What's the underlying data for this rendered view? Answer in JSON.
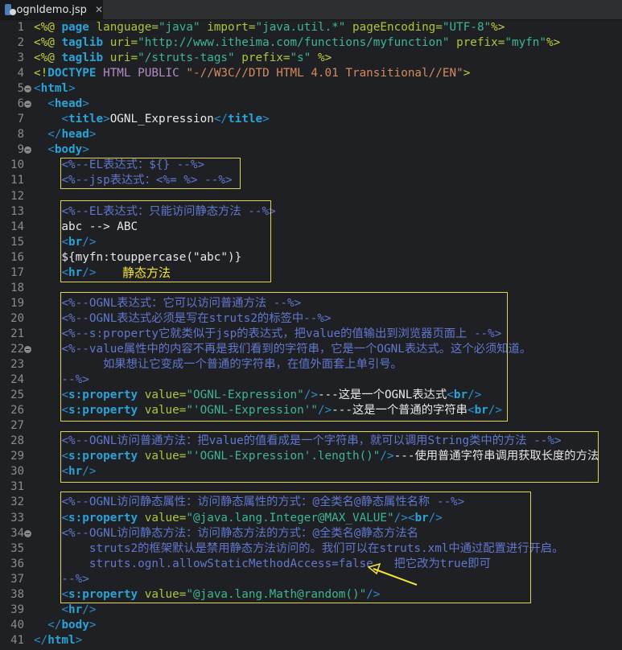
{
  "tab": {
    "title": "ognldemo.jsp",
    "icon": "jsp-file-icon",
    "close_icon": "close-icon"
  },
  "annotation": {
    "label": "静态方法",
    "arrow_icon": "arrow-icon",
    "box_color": "#e3d44a"
  },
  "fold_lines": [
    5,
    6,
    9,
    22,
    34
  ],
  "lines": [
    {
      "n": "1",
      "tokens": [
        [
          "p",
          "<%@ "
        ],
        [
          "kw",
          "page"
        ],
        [
          "at",
          " language="
        ],
        [
          "str",
          "\"java\""
        ],
        [
          "at",
          " import="
        ],
        [
          "str",
          "\"java.util.*\""
        ],
        [
          "at",
          " pageEncoding="
        ],
        [
          "str",
          "\"UTF-8\""
        ],
        [
          "p",
          "%>"
        ]
      ]
    },
    {
      "n": "2",
      "tokens": [
        [
          "p",
          "<%@ "
        ],
        [
          "kw",
          "taglib"
        ],
        [
          "at",
          " uri="
        ],
        [
          "str",
          "\"http://www.itheima.com/functions/myfunction\""
        ],
        [
          "at",
          " prefix="
        ],
        [
          "str",
          "\"myfn\""
        ],
        [
          "p",
          "%>"
        ]
      ]
    },
    {
      "n": "3",
      "tokens": [
        [
          "p",
          "<%@ "
        ],
        [
          "kw",
          "taglib"
        ],
        [
          "at",
          " uri="
        ],
        [
          "str",
          "\"/struts-tags\""
        ],
        [
          "at",
          " prefix="
        ],
        [
          "str",
          "\"s\""
        ],
        [
          "p",
          " %>"
        ]
      ]
    },
    {
      "n": "4",
      "tokens": [
        [
          "p",
          "<!"
        ],
        [
          "kw",
          "DOCTYPE"
        ],
        [
          "pu",
          " HTML PUBLIC "
        ],
        [
          "os",
          "\"-//W3C//DTD HTML 4.01 Transitional//EN\""
        ],
        [
          "p",
          ">"
        ]
      ]
    },
    {
      "n": "5",
      "tokens": [
        [
          "tg",
          "<"
        ],
        [
          "kw",
          "html"
        ],
        [
          "tg",
          ">"
        ]
      ]
    },
    {
      "n": "6",
      "tokens": [
        [
          "tx",
          "  "
        ],
        [
          "tg",
          "<"
        ],
        [
          "kw",
          "head"
        ],
        [
          "tg",
          ">"
        ]
      ]
    },
    {
      "n": "7",
      "tokens": [
        [
          "tx",
          "    "
        ],
        [
          "tg",
          "<"
        ],
        [
          "kw",
          "title"
        ],
        [
          "tg",
          ">"
        ],
        [
          "tx",
          "OGNL_Expression"
        ],
        [
          "tg",
          "</"
        ],
        [
          "kw",
          "title"
        ],
        [
          "tg",
          ">"
        ]
      ]
    },
    {
      "n": "8",
      "tokens": [
        [
          "tx",
          "  "
        ],
        [
          "tg",
          "</"
        ],
        [
          "kw",
          "head"
        ],
        [
          "tg",
          ">"
        ]
      ]
    },
    {
      "n": "9",
      "tokens": [
        [
          "tx",
          "  "
        ],
        [
          "tg",
          "<"
        ],
        [
          "kw",
          "body"
        ],
        [
          "tg",
          ">"
        ]
      ]
    },
    {
      "n": "10",
      "tokens": [
        [
          "tx",
          "    "
        ],
        [
          "cm",
          "<%--EL表达式：${} --%>"
        ]
      ]
    },
    {
      "n": "11",
      "tokens": [
        [
          "tx",
          "    "
        ],
        [
          "cm",
          "<%--jsp表达式：<%= %> --%>"
        ]
      ]
    },
    {
      "n": "12",
      "tokens": []
    },
    {
      "n": "13",
      "tokens": [
        [
          "tx",
          "    "
        ],
        [
          "cm",
          "<%--EL表达式：只能访问静态方法 --%>"
        ]
      ]
    },
    {
      "n": "14",
      "tokens": [
        [
          "tx",
          "    abc --> ABC"
        ]
      ]
    },
    {
      "n": "15",
      "tokens": [
        [
          "tx",
          "    "
        ],
        [
          "tg",
          "<"
        ],
        [
          "kw",
          "br"
        ],
        [
          "tg",
          "/>"
        ]
      ]
    },
    {
      "n": "16",
      "tokens": [
        [
          "tx",
          "    ${myfn:touppercase(\"abc\")}"
        ]
      ]
    },
    {
      "n": "17",
      "tokens": [
        [
          "tx",
          "    "
        ],
        [
          "tg",
          "<"
        ],
        [
          "kw",
          "hr"
        ],
        [
          "tg",
          "/>"
        ]
      ]
    },
    {
      "n": "18",
      "tokens": []
    },
    {
      "n": "19",
      "tokens": [
        [
          "tx",
          "    "
        ],
        [
          "cm",
          "<%--OGNL表达式：它可以访问普通方法 --%>"
        ]
      ]
    },
    {
      "n": "20",
      "tokens": [
        [
          "tx",
          "    "
        ],
        [
          "cm",
          "<%--OGNL表达式必须是写在struts2的标签中--%>"
        ]
      ]
    },
    {
      "n": "21",
      "tokens": [
        [
          "tx",
          "    "
        ],
        [
          "cm",
          "<%--s:property它就类似于jsp的表达式，把value的值输出到浏览器页面上 --%>"
        ]
      ]
    },
    {
      "n": "22",
      "tokens": [
        [
          "tx",
          "    "
        ],
        [
          "cm",
          "<%--value属性中的内容不再是我们看到的字符串，它是一个OGNL表达式。这个必须知道。"
        ]
      ]
    },
    {
      "n": "23",
      "tokens": [
        [
          "cm",
          "          如果想让它变成一个普通的字符串，在值外面套上单引号。"
        ]
      ]
    },
    {
      "n": "24",
      "tokens": [
        [
          "cm",
          "    --%>"
        ]
      ]
    },
    {
      "n": "25",
      "tokens": [
        [
          "tx",
          "    "
        ],
        [
          "tg",
          "<"
        ],
        [
          "kw",
          "s:property"
        ],
        [
          "at",
          " value="
        ],
        [
          "str",
          "\"OGNL-Expression\""
        ],
        [
          "tg",
          "/>"
        ],
        [
          "tx",
          "---这是一个OGNL表达式"
        ],
        [
          "tg",
          "<"
        ],
        [
          "kw",
          "br"
        ],
        [
          "tg",
          "/>"
        ]
      ]
    },
    {
      "n": "26",
      "tokens": [
        [
          "tx",
          "    "
        ],
        [
          "tg",
          "<"
        ],
        [
          "kw",
          "s:property"
        ],
        [
          "at",
          " value="
        ],
        [
          "str",
          "\"'OGNL-Expression'\""
        ],
        [
          "tg",
          "/>"
        ],
        [
          "tx",
          "---这是一个普通的字符串"
        ],
        [
          "tg",
          "<"
        ],
        [
          "kw",
          "br"
        ],
        [
          "tg",
          "/>"
        ]
      ]
    },
    {
      "n": "27",
      "tokens": []
    },
    {
      "n": "28",
      "tokens": [
        [
          "tx",
          "    "
        ],
        [
          "cm",
          "<%--OGNL访问普通方法：把value的值看成是一个字符串，就可以调用String类中的方法 --%>"
        ]
      ]
    },
    {
      "n": "29",
      "tokens": [
        [
          "tx",
          "    "
        ],
        [
          "tg",
          "<"
        ],
        [
          "kw",
          "s:property"
        ],
        [
          "at",
          " value="
        ],
        [
          "str",
          "\"'OGNL-Expression'.length()\""
        ],
        [
          "tg",
          "/>"
        ],
        [
          "tx",
          "---使用普通字符串调用获取长度的方法"
        ]
      ]
    },
    {
      "n": "30",
      "tokens": [
        [
          "tx",
          "    "
        ],
        [
          "tg",
          "<"
        ],
        [
          "kw",
          "hr"
        ],
        [
          "tg",
          "/>"
        ]
      ]
    },
    {
      "n": "31",
      "tokens": []
    },
    {
      "n": "32",
      "tokens": [
        [
          "tx",
          "    "
        ],
        [
          "cm",
          "<%--OGNL访问静态属性：访问静态属性的方式：@全类名@静态属性名称 --%>"
        ]
      ]
    },
    {
      "n": "33",
      "tokens": [
        [
          "tx",
          "    "
        ],
        [
          "tg",
          "<"
        ],
        [
          "kw",
          "s:property"
        ],
        [
          "at",
          " value="
        ],
        [
          "str",
          "\"@java.lang.Integer@MAX_VALUE\""
        ],
        [
          "tg",
          "/><"
        ],
        [
          "kw",
          "br"
        ],
        [
          "tg",
          "/>"
        ]
      ]
    },
    {
      "n": "34",
      "tokens": [
        [
          "tx",
          "    "
        ],
        [
          "cm",
          "<%--OGNL访问静态方法：访问静态方法的方式：@全类名@静态方法名"
        ]
      ]
    },
    {
      "n": "35",
      "tokens": [
        [
          "cm",
          "        struts2的框架默认是禁用静态方法访问的。我们可以在struts.xml中通过配置进行开启。"
        ]
      ]
    },
    {
      "n": "36",
      "tokens": [
        [
          "cm",
          "        struts.ognl.allowStaticMethodAccess=false   把它改为true即可"
        ]
      ]
    },
    {
      "n": "37",
      "tokens": [
        [
          "cm",
          "    --%>"
        ]
      ]
    },
    {
      "n": "38",
      "tokens": [
        [
          "tx",
          "    "
        ],
        [
          "tg",
          "<"
        ],
        [
          "kw",
          "s:property"
        ],
        [
          "at",
          " value="
        ],
        [
          "str",
          "\"@java.lang.Math@random()\""
        ],
        [
          "tg",
          "/>"
        ]
      ]
    },
    {
      "n": "39",
      "tokens": [
        [
          "tx",
          "    "
        ],
        [
          "tg",
          "<"
        ],
        [
          "kw",
          "hr"
        ],
        [
          "tg",
          "/>"
        ]
      ]
    },
    {
      "n": "40",
      "tokens": [
        [
          "tx",
          "  "
        ],
        [
          "tg",
          "</"
        ],
        [
          "kw",
          "body"
        ],
        [
          "tg",
          ">"
        ]
      ]
    },
    {
      "n": "41",
      "tokens": [
        [
          "tg",
          "</"
        ],
        [
          "kw",
          "html"
        ],
        [
          "tg",
          ">"
        ]
      ]
    }
  ]
}
